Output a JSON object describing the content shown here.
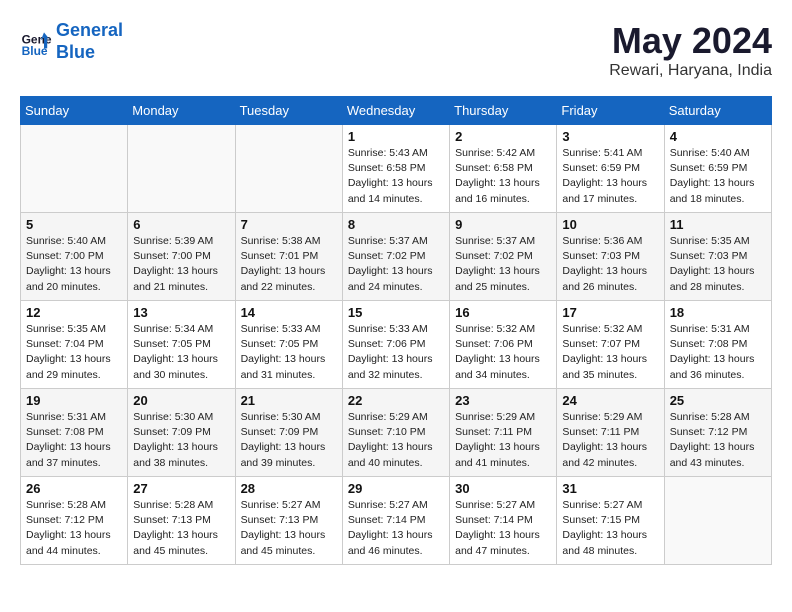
{
  "header": {
    "logo_line1": "General",
    "logo_line2": "Blue",
    "month_year": "May 2024",
    "location": "Rewari, Haryana, India"
  },
  "weekdays": [
    "Sunday",
    "Monday",
    "Tuesday",
    "Wednesday",
    "Thursday",
    "Friday",
    "Saturday"
  ],
  "weeks": [
    [
      {
        "day": "",
        "info": ""
      },
      {
        "day": "",
        "info": ""
      },
      {
        "day": "",
        "info": ""
      },
      {
        "day": "1",
        "info": "Sunrise: 5:43 AM\nSunset: 6:58 PM\nDaylight: 13 hours\nand 14 minutes."
      },
      {
        "day": "2",
        "info": "Sunrise: 5:42 AM\nSunset: 6:58 PM\nDaylight: 13 hours\nand 16 minutes."
      },
      {
        "day": "3",
        "info": "Sunrise: 5:41 AM\nSunset: 6:59 PM\nDaylight: 13 hours\nand 17 minutes."
      },
      {
        "day": "4",
        "info": "Sunrise: 5:40 AM\nSunset: 6:59 PM\nDaylight: 13 hours\nand 18 minutes."
      }
    ],
    [
      {
        "day": "5",
        "info": "Sunrise: 5:40 AM\nSunset: 7:00 PM\nDaylight: 13 hours\nand 20 minutes."
      },
      {
        "day": "6",
        "info": "Sunrise: 5:39 AM\nSunset: 7:00 PM\nDaylight: 13 hours\nand 21 minutes."
      },
      {
        "day": "7",
        "info": "Sunrise: 5:38 AM\nSunset: 7:01 PM\nDaylight: 13 hours\nand 22 minutes."
      },
      {
        "day": "8",
        "info": "Sunrise: 5:37 AM\nSunset: 7:02 PM\nDaylight: 13 hours\nand 24 minutes."
      },
      {
        "day": "9",
        "info": "Sunrise: 5:37 AM\nSunset: 7:02 PM\nDaylight: 13 hours\nand 25 minutes."
      },
      {
        "day": "10",
        "info": "Sunrise: 5:36 AM\nSunset: 7:03 PM\nDaylight: 13 hours\nand 26 minutes."
      },
      {
        "day": "11",
        "info": "Sunrise: 5:35 AM\nSunset: 7:03 PM\nDaylight: 13 hours\nand 28 minutes."
      }
    ],
    [
      {
        "day": "12",
        "info": "Sunrise: 5:35 AM\nSunset: 7:04 PM\nDaylight: 13 hours\nand 29 minutes."
      },
      {
        "day": "13",
        "info": "Sunrise: 5:34 AM\nSunset: 7:05 PM\nDaylight: 13 hours\nand 30 minutes."
      },
      {
        "day": "14",
        "info": "Sunrise: 5:33 AM\nSunset: 7:05 PM\nDaylight: 13 hours\nand 31 minutes."
      },
      {
        "day": "15",
        "info": "Sunrise: 5:33 AM\nSunset: 7:06 PM\nDaylight: 13 hours\nand 32 minutes."
      },
      {
        "day": "16",
        "info": "Sunrise: 5:32 AM\nSunset: 7:06 PM\nDaylight: 13 hours\nand 34 minutes."
      },
      {
        "day": "17",
        "info": "Sunrise: 5:32 AM\nSunset: 7:07 PM\nDaylight: 13 hours\nand 35 minutes."
      },
      {
        "day": "18",
        "info": "Sunrise: 5:31 AM\nSunset: 7:08 PM\nDaylight: 13 hours\nand 36 minutes."
      }
    ],
    [
      {
        "day": "19",
        "info": "Sunrise: 5:31 AM\nSunset: 7:08 PM\nDaylight: 13 hours\nand 37 minutes."
      },
      {
        "day": "20",
        "info": "Sunrise: 5:30 AM\nSunset: 7:09 PM\nDaylight: 13 hours\nand 38 minutes."
      },
      {
        "day": "21",
        "info": "Sunrise: 5:30 AM\nSunset: 7:09 PM\nDaylight: 13 hours\nand 39 minutes."
      },
      {
        "day": "22",
        "info": "Sunrise: 5:29 AM\nSunset: 7:10 PM\nDaylight: 13 hours\nand 40 minutes."
      },
      {
        "day": "23",
        "info": "Sunrise: 5:29 AM\nSunset: 7:11 PM\nDaylight: 13 hours\nand 41 minutes."
      },
      {
        "day": "24",
        "info": "Sunrise: 5:29 AM\nSunset: 7:11 PM\nDaylight: 13 hours\nand 42 minutes."
      },
      {
        "day": "25",
        "info": "Sunrise: 5:28 AM\nSunset: 7:12 PM\nDaylight: 13 hours\nand 43 minutes."
      }
    ],
    [
      {
        "day": "26",
        "info": "Sunrise: 5:28 AM\nSunset: 7:12 PM\nDaylight: 13 hours\nand 44 minutes."
      },
      {
        "day": "27",
        "info": "Sunrise: 5:28 AM\nSunset: 7:13 PM\nDaylight: 13 hours\nand 45 minutes."
      },
      {
        "day": "28",
        "info": "Sunrise: 5:27 AM\nSunset: 7:13 PM\nDaylight: 13 hours\nand 45 minutes."
      },
      {
        "day": "29",
        "info": "Sunrise: 5:27 AM\nSunset: 7:14 PM\nDaylight: 13 hours\nand 46 minutes."
      },
      {
        "day": "30",
        "info": "Sunrise: 5:27 AM\nSunset: 7:14 PM\nDaylight: 13 hours\nand 47 minutes."
      },
      {
        "day": "31",
        "info": "Sunrise: 5:27 AM\nSunset: 7:15 PM\nDaylight: 13 hours\nand 48 minutes."
      },
      {
        "day": "",
        "info": ""
      }
    ]
  ]
}
